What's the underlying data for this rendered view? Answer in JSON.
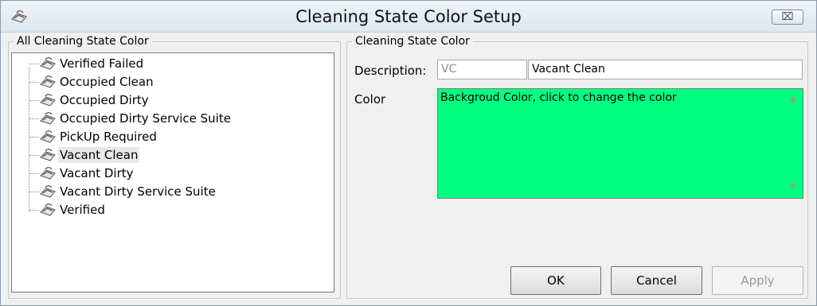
{
  "window": {
    "title": "Cleaning State Color Setup",
    "close_label": "⌧"
  },
  "left_panel": {
    "legend": "All Cleaning State Color",
    "items": [
      {
        "label": "Verified Failed",
        "selected": false
      },
      {
        "label": "Occupied Clean",
        "selected": false
      },
      {
        "label": "Occupied Dirty",
        "selected": false
      },
      {
        "label": "Occupied Dirty Service Suite",
        "selected": false
      },
      {
        "label": "PickUp Required",
        "selected": false
      },
      {
        "label": "Vacant Clean",
        "selected": true
      },
      {
        "label": "Vacant Dirty",
        "selected": false
      },
      {
        "label": "Vacant Dirty Service Suite",
        "selected": false
      },
      {
        "label": "Verified",
        "selected": false
      }
    ]
  },
  "right_panel": {
    "legend": "Cleaning State Color",
    "description_label": "Description:",
    "code_value": "VC",
    "description_value": "Vacant Clean",
    "color_label": "Color",
    "color_hint": "Backgroud Color, click to change the color",
    "color_value": "#00ff80"
  },
  "buttons": {
    "ok": "OK",
    "cancel": "Cancel",
    "apply": "Apply"
  },
  "icons": {
    "app": "cleaning-iron-icon",
    "item": "cleaning-iron-icon"
  }
}
